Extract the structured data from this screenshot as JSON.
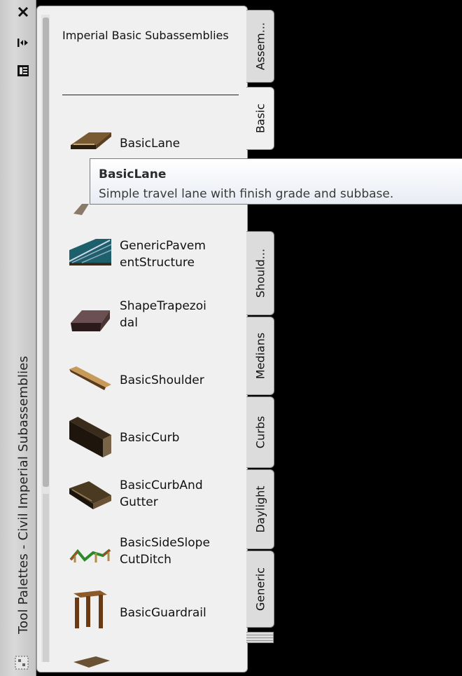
{
  "window": {
    "vertical_title": "Tool Palettes - Civil Imperial Subassemblies",
    "close_icon": "close-icon",
    "autohide_icon": "autohide-icon",
    "menu_icon": "menu-icon",
    "properties_icon": "properties-icon"
  },
  "palette": {
    "header": "Imperial Basic Subassemblies",
    "tools": [
      {
        "label": "BasicLane",
        "icon": "lane-icon"
      },
      {
        "label": "",
        "icon": "partially-hidden-tool-icon"
      },
      {
        "label": "GenericPavem\nentStructure",
        "icon": "pavement-structure-icon"
      },
      {
        "label": "ShapeTrapezoi\ndal",
        "icon": "trapezoid-shape-icon"
      },
      {
        "label": "BasicShoulder",
        "icon": "shoulder-icon"
      },
      {
        "label": "BasicCurb",
        "icon": "curb-icon"
      },
      {
        "label": "BasicCurbAnd\nGutter",
        "icon": "curb-gutter-icon"
      },
      {
        "label": "BasicSideSlope\nCutDitch",
        "icon": "side-slope-ditch-icon"
      },
      {
        "label": "BasicGuardrail",
        "icon": "guardrail-icon"
      },
      {
        "label": "",
        "icon": "partially-hidden-tool-icon"
      }
    ]
  },
  "tabs": [
    {
      "label": "Assem...",
      "active": false
    },
    {
      "label": "Basic",
      "active": true
    },
    {
      "label": "Should...",
      "active": false
    },
    {
      "label": "Medians",
      "active": false
    },
    {
      "label": "Curbs",
      "active": false
    },
    {
      "label": "Daylight",
      "active": false
    },
    {
      "label": "Generic",
      "active": false
    }
  ],
  "tooltip": {
    "title": "BasicLane",
    "description": "Simple travel lane with finish grade and subbase."
  }
}
